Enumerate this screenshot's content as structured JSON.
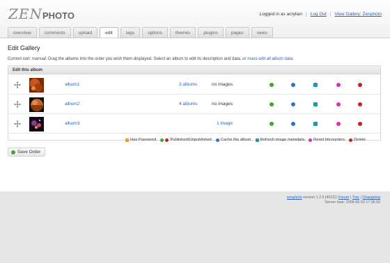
{
  "header": {
    "logo_zen": "ZEN",
    "logo_photo": "PHOTO",
    "logged_in_text": "Logged in as acrylian",
    "logout_label": "Log Out",
    "view_gallery_label": "View Gallery: Zenphoto"
  },
  "tabs": [
    {
      "label": "overview"
    },
    {
      "label": "comments"
    },
    {
      "label": "upload"
    },
    {
      "label": "edit",
      "active": true
    },
    {
      "label": "tags"
    },
    {
      "label": "options"
    },
    {
      "label": "themes"
    },
    {
      "label": "plugins"
    },
    {
      "label": "pages"
    },
    {
      "label": "news"
    }
  ],
  "main": {
    "title": "Edit Gallery",
    "sort_prefix": "Current sort:",
    "sort_value": "manual",
    "sort_suffix": ". Drag the albums into the order you wish them displayed. Select an album to edit its description and data, or",
    "mass_edit_link": "mass-edit all album data",
    "albums_header": "Edit this album",
    "albums": [
      {
        "name": "album1",
        "subalbums": "3 albums",
        "images": "no images"
      },
      {
        "name": "album2",
        "subalbums": "4 albums",
        "images": "no images"
      },
      {
        "name": "album3",
        "subalbums": "",
        "images": "1 image"
      }
    ]
  },
  "legend": {
    "has_password": "Has Password",
    "published": "Published/Unpublished",
    "cache": "Cache the album",
    "refresh": "Refresh image metadata",
    "reset_hits": "Reset hitcounters",
    "delete": "Delete"
  },
  "save_order_label": "Save Order",
  "footer": {
    "brand_link": "zenphoto",
    "version": "version 1.2.5 [4022]",
    "forum_link": "Forum",
    "trac_link": "Trac",
    "changelog_link": "Changelog",
    "server_date": "Server date: 2009-06-03 17:36:53"
  },
  "colors": {
    "link": "#2a62bd",
    "published": "#4aa02c",
    "unpublished": "#cc2222",
    "cache": "#3b6ec4",
    "refresh": "#1f9bb0",
    "reset": "#d62fb8",
    "delete": "#cc2020",
    "password": "#e8a020"
  }
}
